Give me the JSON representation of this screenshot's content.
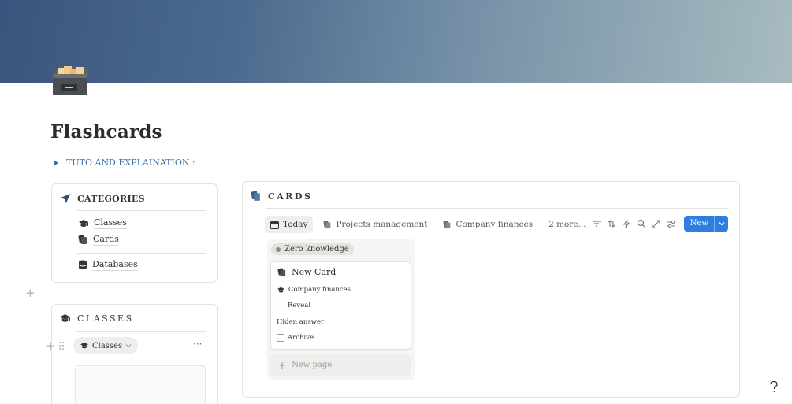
{
  "page": {
    "title": "Flashcards",
    "icon": "card-file-box-icon",
    "cover_colors": [
      "#3a557d",
      "#7792a8",
      "#a8bcc0"
    ]
  },
  "toggle": {
    "label": "TUTO AND EXPLAINATION :"
  },
  "categories": {
    "title": "CATEGORIES",
    "icon": "navigation-arrow-icon",
    "items": [
      {
        "label": "Classes",
        "icon": "graduation-cap-icon"
      },
      {
        "label": "Cards",
        "icon": "cards-icon"
      },
      {
        "label": "Databases",
        "icon": "database-icon"
      }
    ]
  },
  "classes": {
    "title": "CLASSES",
    "icon": "graduation-cap-icon",
    "view": {
      "label": "Classes"
    },
    "more": "···"
  },
  "cards": {
    "title": "CARDS",
    "icon": "cards-icon",
    "tabs": [
      {
        "label": "Today",
        "icon": "calendar-icon",
        "active": true
      },
      {
        "label": "Projects management",
        "icon": "cards-icon",
        "active": false
      },
      {
        "label": "Company finances",
        "icon": "cards-icon",
        "active": false
      }
    ],
    "more_tabs": "2 more...",
    "toolbar": {
      "new_label": "New",
      "accent": "#2f7fe2"
    },
    "board": {
      "group_label": "Zero knowledge",
      "card": {
        "title": "New Card",
        "class": "Company finances",
        "reveal": "Reveal",
        "hidden_answer": "Hiden answer",
        "archive": "Archive"
      },
      "new_page": "New page"
    }
  },
  "help": {
    "label": "?"
  }
}
